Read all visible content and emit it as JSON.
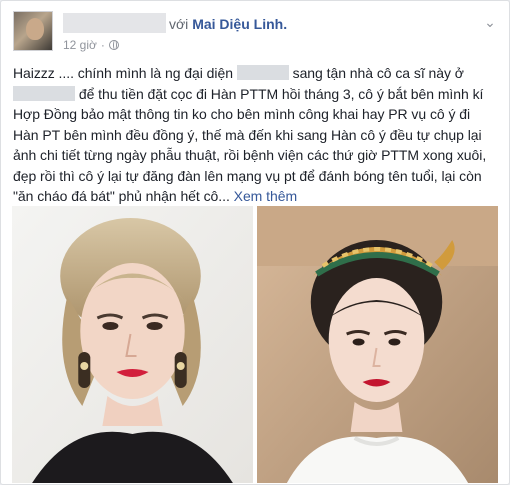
{
  "post": {
    "author_redacted": true,
    "with_prefix": "với",
    "tagged_friend": "Mai Diệu Linh.",
    "timestamp": "12 giờ",
    "separator": "·",
    "privacy_icon": "globe-icon",
    "menu_icon": "chevron-down-icon",
    "text": {
      "l1_a": "Haizzz .... chính mình là ng đại diện",
      "l1_b": "sang tận nhà cô ca sĩ này ở",
      "l2_b": "để thu tiền đặt cọc đi Hàn PTTM hồi tháng 3, cô ý bắt bên mình kí",
      "l3": "Hợp Đồng bảo mật thông tin ko cho bên mình công khai hay PR vụ cô ý đi",
      "l4": "Hàn PT bên mình đều đồng ý, thế mà đến khi sang Hàn cô ý đều tự chụp lại",
      "l5": "ảnh chi tiết từng ngày phẫu thuật, rồi bệnh viện các thứ giờ PTTM xong xuôi,",
      "l6": "đẹp rồi thì cô ý lại tự đăng đàn lên mạng vụ pt để đánh bóng tên tuổi, lại còn",
      "l7": "\"ăn cháo đá bát\" phủ nhận hết cô...",
      "see_more": "Xem thêm"
    }
  },
  "colors": {
    "link": "#365899",
    "text": "#1d2129",
    "meta": "#90949c",
    "redaction": "#dadde1"
  }
}
